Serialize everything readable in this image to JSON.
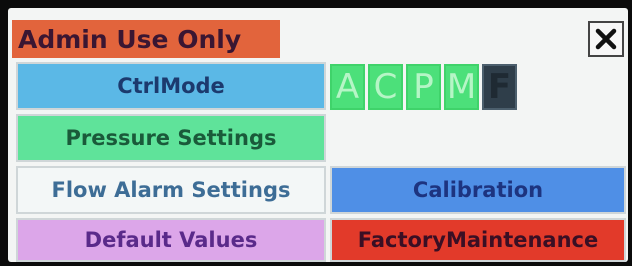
{
  "dialog": {
    "title": "Admin Use Only",
    "close_icon": "close-icon"
  },
  "buttons": {
    "ctrl_mode": "CtrlMode",
    "pressure_settings": "Pressure Settings",
    "flow_alarm_settings": "Flow Alarm Settings",
    "default_values": "Default Values",
    "calibration": "Calibration",
    "factory_maintenance": "FactoryMaintenance"
  },
  "modes": [
    {
      "label": "A",
      "state": "active"
    },
    {
      "label": "C",
      "state": "active"
    },
    {
      "label": "P",
      "state": "active"
    },
    {
      "label": "M",
      "state": "active"
    },
    {
      "label": "F",
      "state": "inactive"
    }
  ],
  "colors": {
    "title_bar": "#e2643c",
    "ctrl_mode": "#5bb8e6",
    "pressure_settings": "#5fe39a",
    "flow_alarm_settings": "#f3f7f7",
    "default_values": "#dca6e9",
    "calibration": "#4f8fe6",
    "factory_maintenance": "#e23a2a",
    "mode_active": "#4ce07a",
    "mode_inactive": "#2f3e4a"
  }
}
